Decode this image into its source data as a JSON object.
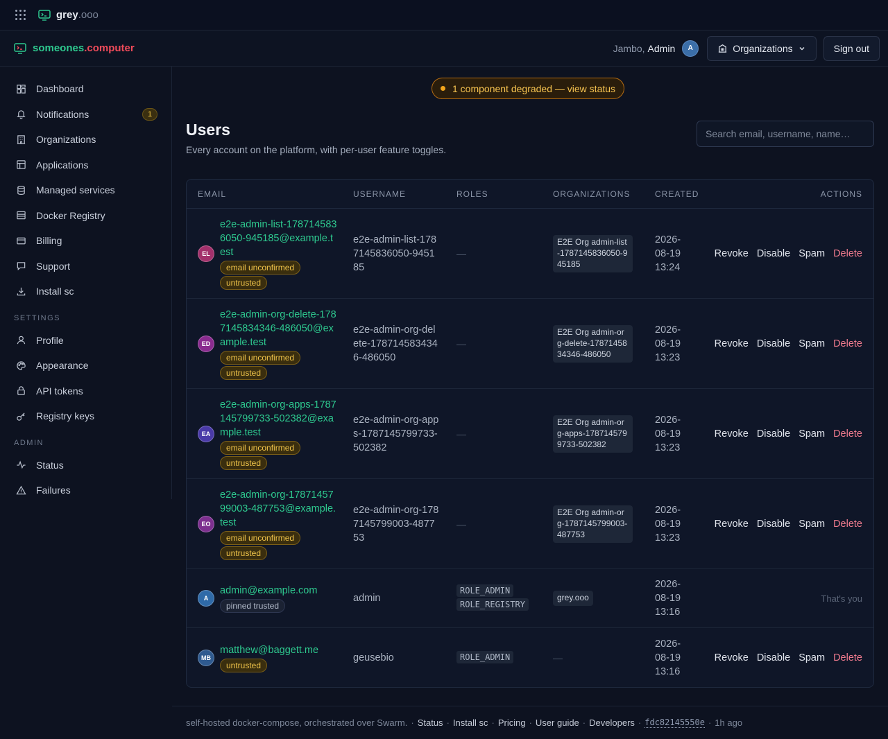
{
  "topbar": {
    "brand_main": "grey",
    "brand_suffix": ".ooo"
  },
  "navbar": {
    "brand_part1": "someones",
    "brand_part2": ".computer",
    "greeting": "Jambo,",
    "user": "Admin",
    "avatar_initial": "A",
    "orgs_button": "Organizations",
    "signout_button": "Sign out"
  },
  "sidebar": {
    "items": [
      {
        "label": "Dashboard",
        "icon": "dashboard-icon"
      },
      {
        "label": "Notifications",
        "icon": "bell-icon",
        "badge": "1"
      },
      {
        "label": "Organizations",
        "icon": "building-icon"
      },
      {
        "label": "Applications",
        "icon": "layout-icon"
      },
      {
        "label": "Managed services",
        "icon": "database-icon"
      },
      {
        "label": "Docker Registry",
        "icon": "server-icon"
      },
      {
        "label": "Billing",
        "icon": "card-icon"
      },
      {
        "label": "Support",
        "icon": "chat-icon"
      },
      {
        "label": "Install sc",
        "icon": "download-icon"
      }
    ],
    "settings_heading": "SETTINGS",
    "settings_items": [
      {
        "label": "Profile",
        "icon": "user-icon"
      },
      {
        "label": "Appearance",
        "icon": "palette-icon"
      },
      {
        "label": "API tokens",
        "icon": "lock-icon"
      },
      {
        "label": "Registry keys",
        "icon": "key-icon"
      }
    ],
    "admin_heading": "ADMIN",
    "admin_items": [
      {
        "label": "Status",
        "icon": "activity-icon"
      },
      {
        "label": "Failures",
        "icon": "warning-icon"
      }
    ]
  },
  "main": {
    "status_banner": "1 component degraded — view status",
    "title": "Users",
    "subtitle": "Every account on the platform, with per-user feature toggles.",
    "search_placeholder": "Search email, username, name…",
    "columns": [
      "EMAIL",
      "USERNAME",
      "ROLES",
      "ORGANIZATIONS",
      "CREATED",
      "ACTIONS"
    ],
    "actions": {
      "revoke": "Revoke",
      "disable": "Disable",
      "spam": "Spam",
      "delete": "Delete",
      "self": "That's you"
    },
    "dash": "—",
    "rows": [
      {
        "initials": "EL",
        "avatar_color": "#a3306b",
        "email": "e2e-admin-list-1787145836050-945185@example.test",
        "tags": [
          "email unconfirmed",
          "untrusted"
        ],
        "username": "e2e-admin-list-1787145836050-945185",
        "org": "E2E Org admin-list-1787145836050-945185",
        "created": "2026-08-19 13:24"
      },
      {
        "initials": "ED",
        "avatar_color": "#8a2b8f",
        "email": "e2e-admin-org-delete-1787145834346-486050@example.test",
        "tags": [
          "email unconfirmed",
          "untrusted"
        ],
        "username": "e2e-admin-org-delete-1787145834346-486050",
        "org": "E2E Org admin-org-delete-1787145834346-486050",
        "created": "2026-08-19 13:23"
      },
      {
        "initials": "EA",
        "avatar_color": "#4a3aa8",
        "email": "e2e-admin-org-apps-1787145799733-502382@example.test",
        "tags": [
          "email unconfirmed",
          "untrusted"
        ],
        "username": "e2e-admin-org-apps-1787145799733-502382",
        "org": "E2E Org admin-org-apps-1787145799733-502382",
        "created": "2026-08-19 13:23"
      },
      {
        "initials": "EO",
        "avatar_color": "#7d2f8f",
        "email": "e2e-admin-org-1787145799003-487753@example.test",
        "tags": [
          "email unconfirmed",
          "untrusted"
        ],
        "username": "e2e-admin-org-1787145799003-487753",
        "org": "E2E Org admin-org-1787145799003-487753",
        "created": "2026-08-19 13:23"
      },
      {
        "initials": "A",
        "avatar_color": "#2f6aa8",
        "email": "admin@example.com",
        "tags": [
          "pinned trusted"
        ],
        "username": "admin",
        "roles": [
          "ROLE_ADMIN",
          "ROLE_REGISTRY"
        ],
        "org": "grey.ooo",
        "created": "2026-08-19 13:16",
        "is_self": true
      },
      {
        "initials": "MB",
        "avatar_color": "#2f5a8f",
        "email": "matthew@baggett.me",
        "tags": [
          "untrusted"
        ],
        "username": "geusebio",
        "roles": [
          "ROLE_ADMIN"
        ],
        "created": "2026-08-19 13:16"
      }
    ]
  },
  "footer": {
    "text": "self-hosted docker-compose, orchestrated over Swarm.",
    "links": [
      "Status",
      "Install sc",
      "Pricing",
      "User guide",
      "Developers"
    ],
    "hash": "fdc82145550e",
    "ago": "1h ago"
  }
}
